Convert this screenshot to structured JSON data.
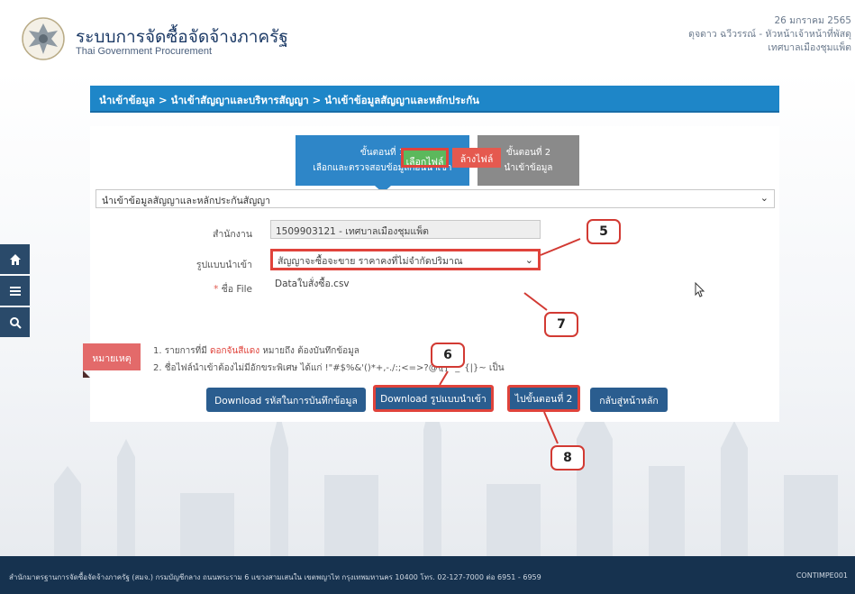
{
  "header": {
    "title": "ระบบการจัดซื้อจัดจ้างภาครัฐ",
    "subtitle": "Thai Government Procurement",
    "date": "26 มกราคม 2565",
    "user": "ดุจดาว ฉวีวรรณ์ - หัวหน้าเจ้าหน้าที่พัสดุ",
    "org": "เทศบาลเมืองชุมแพ็ต"
  },
  "breadcrumb": "นำเข้าข้อมูล > นำเข้าสัญญาและบริหารสัญญา > นำเข้าข้อมูลสัญญาและหลักประกัน",
  "steps": [
    {
      "line1": "ขั้นตอนที่ 1",
      "line2": "เลือกและตรวจสอบข้อมูลก่อนนำเข้า"
    },
    {
      "line1": "ขั้นตอนที่ 2",
      "line2": "นำเข้าข้อมูล"
    }
  ],
  "import_type_select": "นำเข้าข้อมูลสัญญาและหลักประกันสัญญา",
  "form": {
    "office_label": "สำนักงาน",
    "office_value": "1509903121 - เทศบาลเมืองชุมแพ็ต",
    "format_label": "รูปแบบนำเข้า",
    "format_value": "สัญญาจะซื้อจะขาย ราคาคงที่ไม่จำกัดปริมาณ",
    "file_label": "ชื่อ File",
    "file_required": "*",
    "file_value": "Dataใบสั่งซื้อ.csv",
    "choose_file": "เลือกไฟล์",
    "clear_file": "ล้างไฟล์"
  },
  "note": {
    "label": "หมายเหตุ",
    "line1_prefix": "1. รายการที่มี ",
    "line1_red": "ดอกจันสีแดง",
    "line1_suffix": " หมายถึง ต้องบันทึกข้อมูล",
    "line2": "2. ชื่อไฟล์นำเข้าต้องไม่มีอักขระพิเศษ ได้แก่ !\"#$%&'()*+,-./:;<=>?@\\[]^_`{|}~ เป็น"
  },
  "buttons": {
    "download_codes": "Download รหัสในการบันทึกข้อมูล",
    "download_template": "Download รูปแบบนำเข้า",
    "next_step": "ไปขั้นตอนที่ 2",
    "home": "กลับสู่หน้าหลัก"
  },
  "callouts": [
    "5",
    "6",
    "7",
    "8"
  ],
  "footer": {
    "text": "สำนักมาตรฐานการจัดซื้อจัดจ้างภาครัฐ (สมจ.) กรมบัญชีกลาง ถนนพระราม 6 แขวงสามเสนใน เขตพญาไท กรุงเทพมหานคร 10400 โทร. 02-127-7000 ต่อ 6951 - 6959",
    "code": "CONTIMPE001"
  },
  "icons": [
    "home-icon",
    "menu-icon",
    "search-icon",
    "chevron-down-icon",
    "cursor-icon"
  ],
  "colors": {
    "accent": "#1e86c8",
    "highlight": "#e0433b",
    "button": "#2a5d8f",
    "footer": "#16324f"
  }
}
